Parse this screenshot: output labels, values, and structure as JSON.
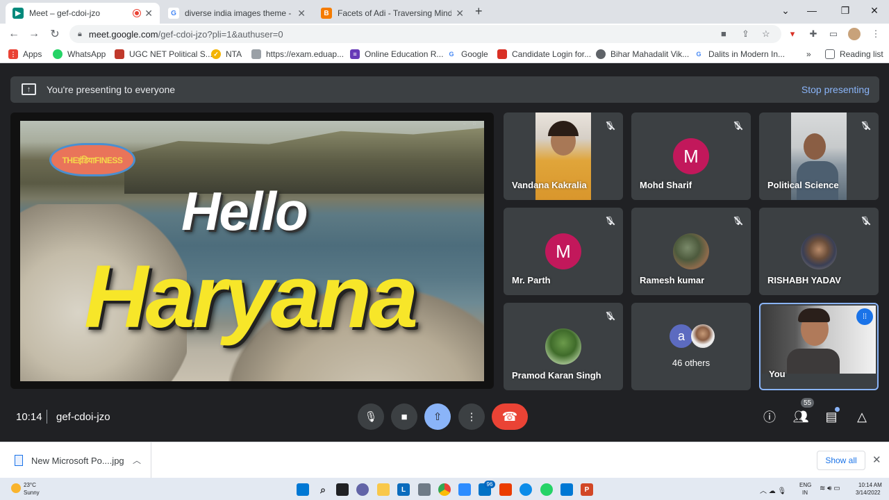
{
  "browser": {
    "tabs": [
      {
        "title": "Meet – gef-cdoi-jzo",
        "favicon": "meet-icon"
      },
      {
        "title": "diverse india images theme - Go",
        "favicon": "google-icon"
      },
      {
        "title": "Facets of Adi - Traversing Mind: T",
        "favicon": "blogger-icon"
      }
    ],
    "new_tab_label": "+",
    "url_host": "meet.google.com",
    "url_path": "/gef-cdoi-jzo?pli=1&authuser=0",
    "bookmarks": [
      {
        "label": "Apps",
        "icon": "apps-grid-icon",
        "color": "#ea4335"
      },
      {
        "label": "WhatsApp",
        "icon": "whatsapp-icon",
        "color": "#25d366"
      },
      {
        "label": "UGC NET Political S...",
        "icon": "ugc-icon",
        "color": "#c0392b"
      },
      {
        "label": "NTA",
        "icon": "nta-icon",
        "color": "#f4b400"
      },
      {
        "label": "https://exam.eduap...",
        "icon": "doc-icon",
        "color": "#9aa0a6"
      },
      {
        "label": "Online Education R...",
        "icon": "form-icon",
        "color": "#673ab7"
      },
      {
        "label": "Google",
        "icon": "google-icon",
        "color": "#4285f4"
      },
      {
        "label": "Candidate Login for...",
        "icon": "candidate-icon",
        "color": "#d93025"
      },
      {
        "label": "Bihar Mahadalit Vik...",
        "icon": "globe-icon",
        "color": "#5f6368"
      },
      {
        "label": "Dalits in Modern In...",
        "icon": "google-icon",
        "color": "#4285f4"
      }
    ],
    "bookmarks_overflow": "»",
    "reading_list": "Reading list"
  },
  "meet": {
    "banner_text": "You're presenting to everyone",
    "stop_presenting": "Stop presenting",
    "slide": {
      "logo_text": "THEइंडियाFINESS",
      "hello": "Hello",
      "haryana": "Haryana"
    },
    "participants": [
      {
        "name": "Vandana Kakralia",
        "type": "video",
        "muted": true
      },
      {
        "name": "Mohd Sharif",
        "type": "initial",
        "initial": "M",
        "color": "#c2185b",
        "muted": true
      },
      {
        "name": "Political Science",
        "type": "video",
        "muted": true
      },
      {
        "name": "Mr. Parth",
        "type": "initial",
        "initial": "M",
        "color": "#c2185b",
        "muted": true
      },
      {
        "name": "Ramesh kumar",
        "type": "photo",
        "muted": true
      },
      {
        "name": "RISHABH YADAV",
        "type": "photo",
        "muted": true
      },
      {
        "name": "Pramod Karan Singh",
        "type": "photo",
        "muted": true
      },
      {
        "name": "46 others",
        "type": "group",
        "initial": "a"
      },
      {
        "name": "You",
        "type": "self",
        "speaking": true
      }
    ],
    "clock": "10:14",
    "meeting_code": "gef-cdoi-jzo",
    "people_count": "55",
    "controls": [
      "mic-icon",
      "camera-icon",
      "present-icon",
      "more-icon",
      "end-call-icon"
    ],
    "right_controls": [
      "info-icon",
      "people-icon",
      "chat-icon",
      "activities-icon"
    ]
  },
  "downloads": {
    "file_name": "New Microsoft Po....jpg",
    "show_all": "Show all"
  },
  "taskbar": {
    "temperature": "23°C",
    "weather": "Sunny",
    "lang_1": "ENG",
    "lang_2": "IN",
    "time": "10:14 AM",
    "date": "3/14/2022",
    "mail_badge": "96"
  },
  "colors": {
    "accent": "#8ab4f8",
    "end_call": "#ea4335",
    "present_active": "#8ab4f8"
  }
}
